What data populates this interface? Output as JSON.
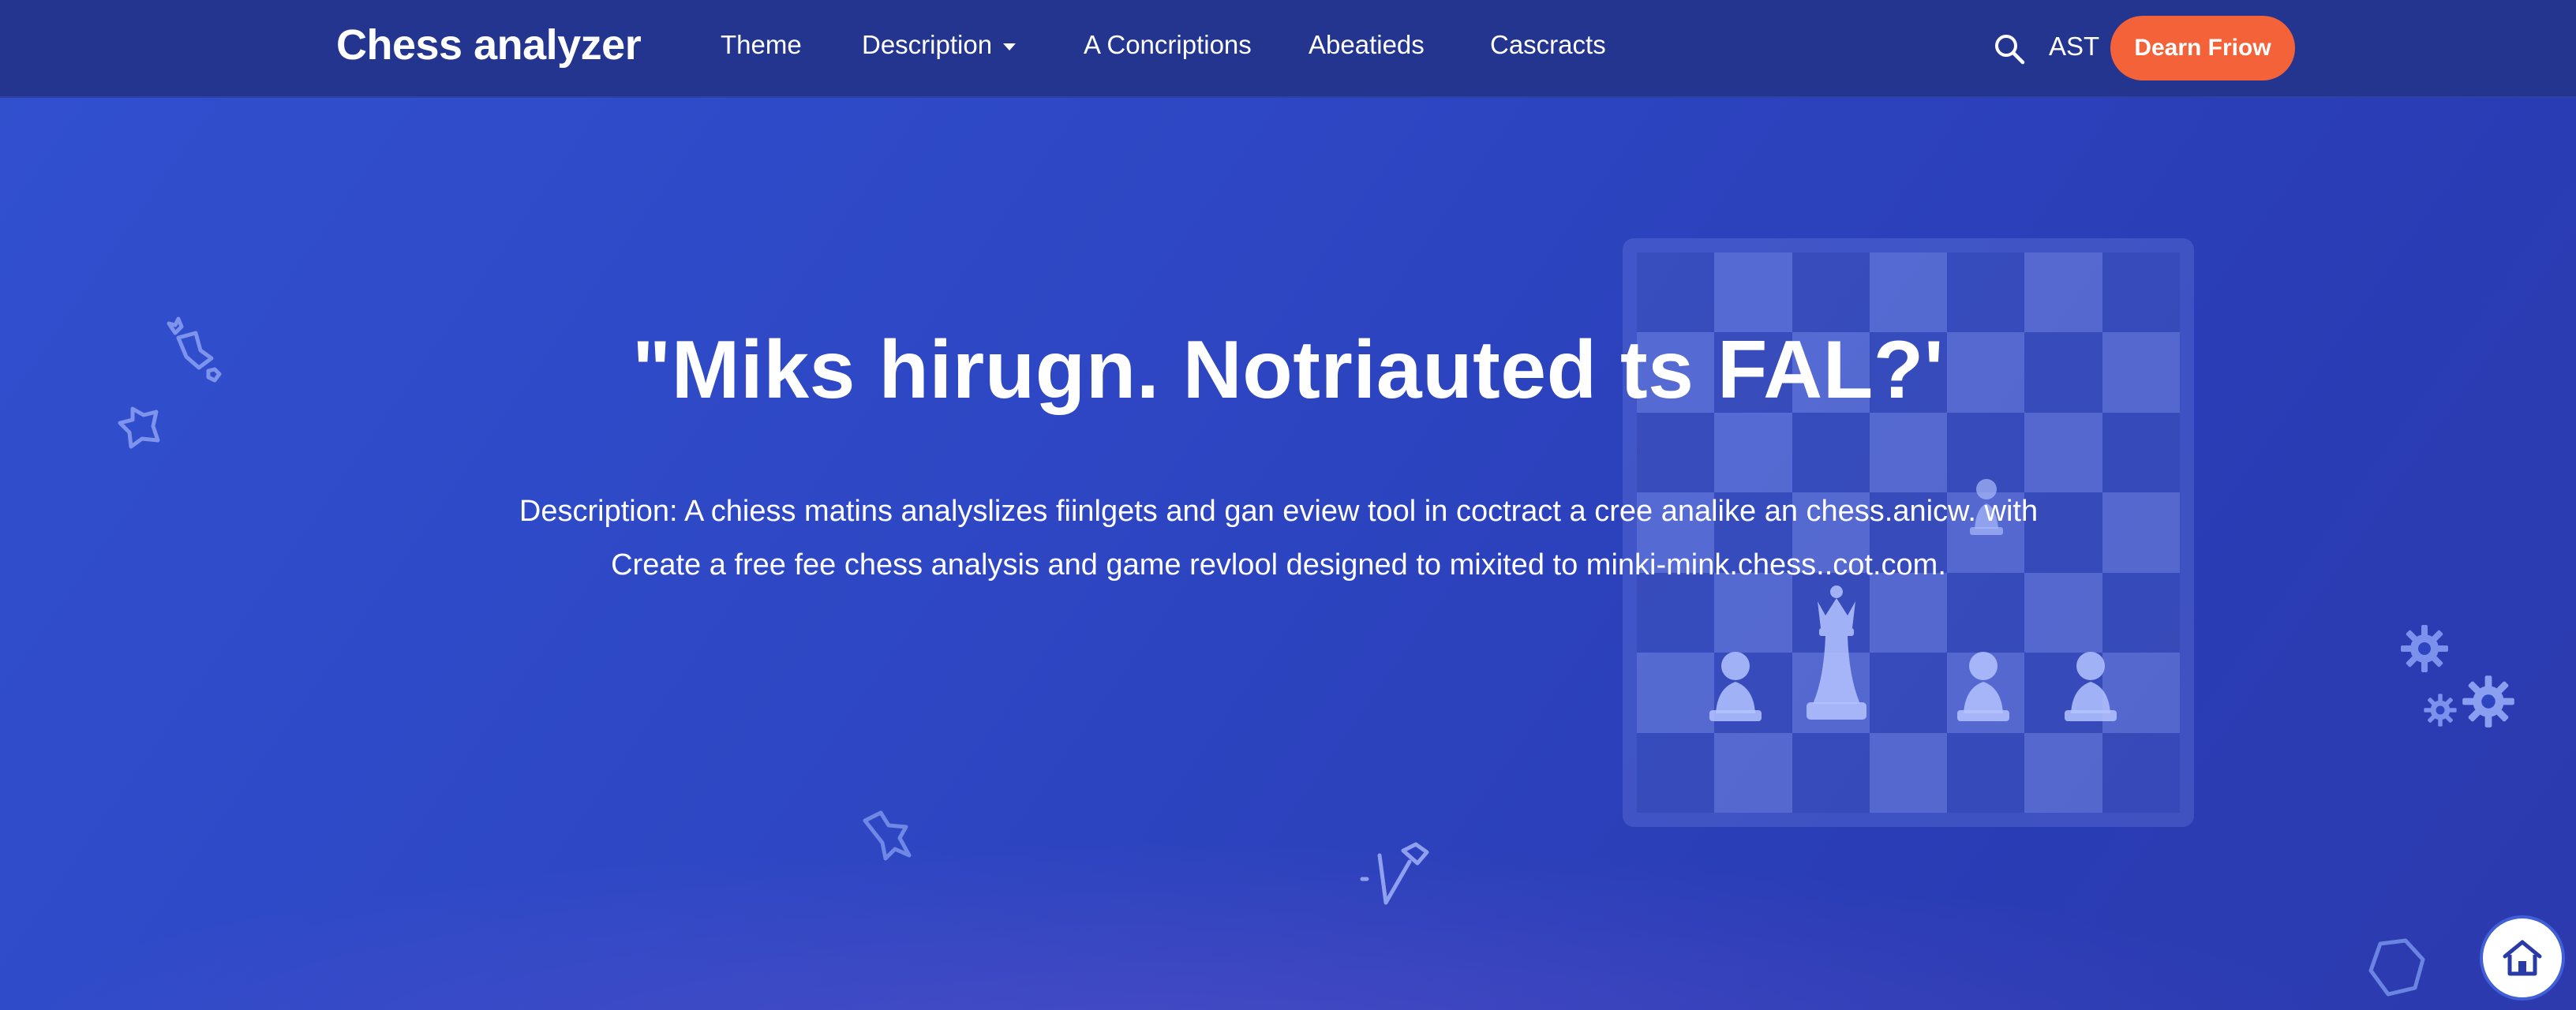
{
  "brand": "Chess analyzer",
  "nav": {
    "links": [
      "Theme",
      "Description",
      "A Concriptions",
      "Abeatieds",
      "Cascracts"
    ],
    "language": "AST",
    "cta_label": "Dearn Friow"
  },
  "hero": {
    "headline": "\"Miks hirugn. Notriauted ts FAL?'",
    "description_line1": "Description: A chiess matins analyslizes fiinlgets and gan eview tool in coctract a cree analike an chess.anicw. with",
    "description_line2": "Create a free fee chess analysis and game revlool designed to mixited to minki-mink.chess..cot.com."
  },
  "colors": {
    "nav_bg": "#24358f",
    "hero_bg": "#2e47c4",
    "cta": "#f4623a"
  },
  "icons": [
    "search-icon",
    "star-doodle-icon",
    "gear-icon",
    "home-icon",
    "pawn-icon",
    "queen-icon"
  ]
}
